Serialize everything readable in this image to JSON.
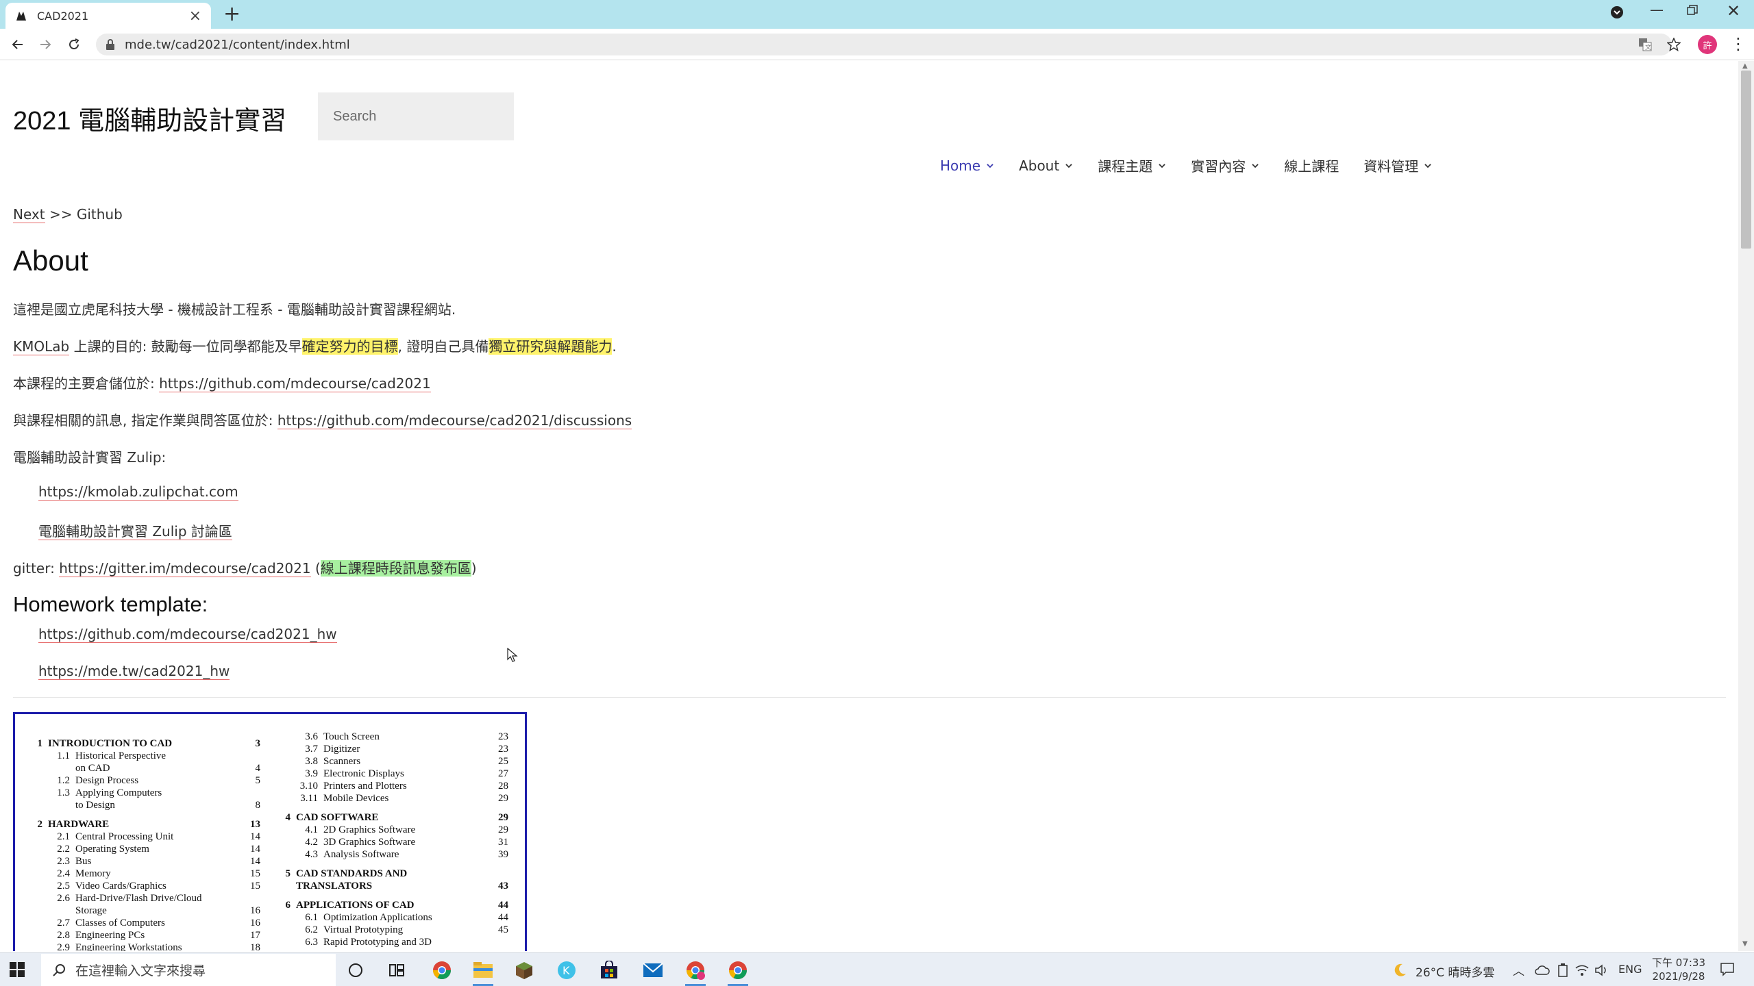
{
  "browser": {
    "tab_title": "CAD2021",
    "new_tab": "+",
    "url": "mde.tw/cad2021/content/index.html",
    "profile_initial": "許"
  },
  "site": {
    "title": "2021 電腦輔助設計實習",
    "search_placeholder": "Search"
  },
  "nav": {
    "items": [
      {
        "label": "Home",
        "active": true,
        "dropdown": true
      },
      {
        "label": "About",
        "dropdown": true
      },
      {
        "label": "課程主題",
        "dropdown": true
      },
      {
        "label": "實習內容",
        "dropdown": true
      },
      {
        "label": "線上課程",
        "dropdown": false
      },
      {
        "label": "資料管理",
        "dropdown": true
      }
    ]
  },
  "breadcrumb": {
    "next": "Next",
    "sep": " >> ",
    "current": "Github"
  },
  "content": {
    "heading": "About",
    "intro": "這裡是國立虎尾科技大學 - 機械設計工程系 - 電腦輔助設計實習課程網站.",
    "purpose_link": "KMOLab",
    "purpose_a": " 上課的目的: 鼓勵每一位同學都能及早",
    "purpose_hl1": "確定努力的目標",
    "purpose_b": ", 證明自己具備",
    "purpose_hl2": "獨立研究與解題能力",
    "purpose_c": ".",
    "repo_label": "本課程的主要倉儲位於: ",
    "repo_link": "https://github.com/mdecourse/cad2021",
    "discuss_label": "與課程相關的訊息, 指定作業與問答區位於: ",
    "discuss_link": "https://github.com/mdecourse/cad2021/discussions",
    "zulip_label": "電腦輔助設計實習 Zulip:",
    "zulip_link1": "https://kmolab.zulipchat.com",
    "zulip_link2": "電腦輔助設計實習 Zulip 討論區",
    "gitter_label": "gitter: ",
    "gitter_link": "https://gitter.im/mdecourse/cad2021",
    "gitter_open": " (",
    "gitter_note": "線上課程時段訊息發布區",
    "gitter_close": ")",
    "hw_heading": "Homework template:",
    "hw_link1": "https://github.com/mdecourse/cad2021_hw",
    "hw_link2": "https://mde.tw/cad2021_hw"
  },
  "toc": {
    "left": [
      {
        "type": "chap",
        "num": "1",
        "title": "INTRODUCTION TO CAD",
        "page": "3"
      },
      {
        "type": "sub",
        "num": "1.1",
        "title": "Historical Perspective",
        "page": ""
      },
      {
        "type": "sub",
        "num": "",
        "title": "on CAD",
        "page": "4"
      },
      {
        "type": "sub",
        "num": "1.2",
        "title": "Design Process",
        "page": "5"
      },
      {
        "type": "sub",
        "num": "1.3",
        "title": "Applying Computers",
        "page": ""
      },
      {
        "type": "sub",
        "num": "",
        "title": "to Design",
        "page": "8"
      },
      {
        "type": "chap",
        "num": "2",
        "title": "HARDWARE",
        "page": "13"
      },
      {
        "type": "sub",
        "num": "2.1",
        "title": "Central Processing Unit",
        "page": "14"
      },
      {
        "type": "sub",
        "num": "2.2",
        "title": "Operating System",
        "page": "14"
      },
      {
        "type": "sub",
        "num": "2.3",
        "title": "Bus",
        "page": "14"
      },
      {
        "type": "sub",
        "num": "2.4",
        "title": "Memory",
        "page": "15"
      },
      {
        "type": "sub",
        "num": "2.5",
        "title": "Video Cards/Graphics",
        "page": "15"
      },
      {
        "type": "sub",
        "num": "2.6",
        "title": "Hard-Drive/Flash Drive/Cloud",
        "page": ""
      },
      {
        "type": "sub",
        "num": "",
        "title": "Storage",
        "page": "16"
      },
      {
        "type": "sub",
        "num": "2.7",
        "title": "Classes of Computers",
        "page": "16"
      },
      {
        "type": "sub",
        "num": "2.8",
        "title": "Engineering PCs",
        "page": "17"
      },
      {
        "type": "sub",
        "num": "2.9",
        "title": "Engineering Workstations",
        "page": "18"
      }
    ],
    "right": [
      {
        "type": "sub",
        "num": "3.6",
        "title": "Touch Screen",
        "page": "23"
      },
      {
        "type": "sub",
        "num": "3.7",
        "title": "Digitizer",
        "page": "23"
      },
      {
        "type": "sub",
        "num": "3.8",
        "title": "Scanners",
        "page": "25"
      },
      {
        "type": "sub",
        "num": "3.9",
        "title": "Electronic Displays",
        "page": "27"
      },
      {
        "type": "sub",
        "num": "3.10",
        "title": "Printers and Plotters",
        "page": "28"
      },
      {
        "type": "sub",
        "num": "3.11",
        "title": "Mobile Devices",
        "page": "29"
      },
      {
        "type": "chap",
        "num": "4",
        "title": "CAD SOFTWARE",
        "page": "29"
      },
      {
        "type": "sub",
        "num": "4.1",
        "title": "2D Graphics Software",
        "page": "29"
      },
      {
        "type": "sub",
        "num": "4.2",
        "title": "3D Graphics Software",
        "page": "31"
      },
      {
        "type": "sub",
        "num": "4.3",
        "title": "Analysis Software",
        "page": "39"
      },
      {
        "type": "chap",
        "num": "5",
        "title": "CAD STANDARDS AND",
        "page": ""
      },
      {
        "type": "chap2",
        "num": "",
        "title": "TRANSLATORS",
        "page": "43"
      },
      {
        "type": "chap",
        "num": "6",
        "title": "APPLICATIONS OF CAD",
        "page": "44"
      },
      {
        "type": "sub",
        "num": "6.1",
        "title": "Optimization Applications",
        "page": "44"
      },
      {
        "type": "sub",
        "num": "6.2",
        "title": "Virtual Prototyping",
        "page": "45"
      },
      {
        "type": "sub",
        "num": "6.3",
        "title": "Rapid Prototyping and 3D",
        "page": ""
      }
    ]
  },
  "taskbar": {
    "search_placeholder": "在這裡輸入文字來搜尋",
    "weather": "26°C  晴時多雲",
    "ime": "ENG",
    "time": "下午 07:33",
    "date": "2021/9/28"
  },
  "colors": {
    "tabstrip": "#b4e4ee",
    "nav_active": "#3a3ab0",
    "link_underline": "#e66a6a",
    "highlight_yellow": "#fff36b",
    "highlight_green": "#a8f0a0",
    "toc_border": "#1c1caa"
  }
}
